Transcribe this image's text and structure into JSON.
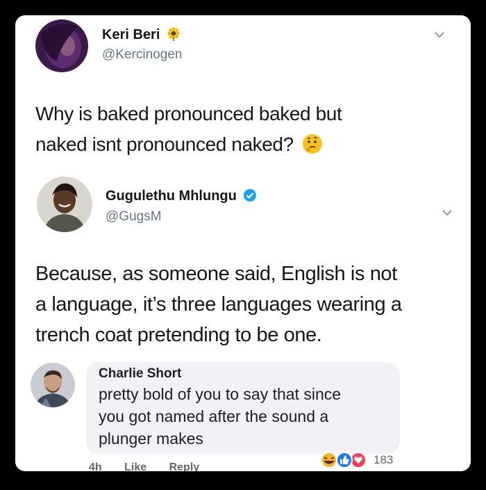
{
  "tweet1": {
    "name": "Keri Beri",
    "handle": "@Kercinogen",
    "name_icon": "sunflower-emoji",
    "text_line1": "Why is baked pronounced baked but",
    "text_line2": "naked isnt pronounced naked?",
    "end_icon": "thinking-face-emoji"
  },
  "tweet2": {
    "name": "Gugulethu Mhlungu",
    "handle": "@GugsM",
    "name_icon": "verified-badge",
    "text_line1": "Because, as someone said, English is not",
    "text_line2": "a language, it’s three languages wearing a",
    "text_line3": "trench coat pretending to be one."
  },
  "fb_comment": {
    "name": "Charlie Short",
    "text_line1": "pretty bold of you to say that since",
    "text_line2": "you got named after the sound a",
    "text_line3": "plunger makes",
    "time": "4h",
    "like_label": "Like",
    "reply_label": "Reply",
    "reaction_icons": [
      "laugh-reaction-icon",
      "like-reaction-icon",
      "love-reaction-icon"
    ],
    "reaction_count": "183"
  },
  "colors": {
    "background": "#000000",
    "card": "#ffffff",
    "text": "#14171a",
    "muted": "#657786",
    "verified": "#1da1f2",
    "bubble": "#f0f2f5"
  }
}
